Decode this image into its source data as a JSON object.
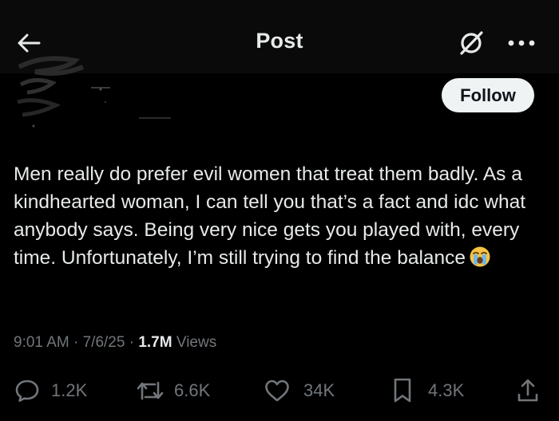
{
  "header": {
    "title": "Post",
    "back_icon": "arrow-left-icon",
    "grok_icon": "grok-icon",
    "more_icon": "more-horizontal-icon"
  },
  "author": {
    "follow_label": "Follow"
  },
  "tweet": {
    "text": "Men really do prefer evil women that treat them badly. As a kindhearted woman, I can tell you that’s a fact and idc what anybody says. Being very nice gets you played with, every time. Unfortunately, I’m still trying to find the balance",
    "emoji": "loudly-crying-face-icon"
  },
  "meta": {
    "time": "9:01 AM",
    "sep1": " · ",
    "date": "7/6/25",
    "sep2": " · ",
    "views_count": "1.7M",
    "views_label": "Views"
  },
  "actions": {
    "replies": "1.2K",
    "reposts": "6.6K",
    "likes": "34K",
    "bookmarks": "4.3K"
  },
  "colors": {
    "background": "#000000",
    "text_primary": "#e7e9ea",
    "text_secondary": "#71767b",
    "follow_bg": "#eff3f4",
    "follow_text": "#0f1419"
  }
}
